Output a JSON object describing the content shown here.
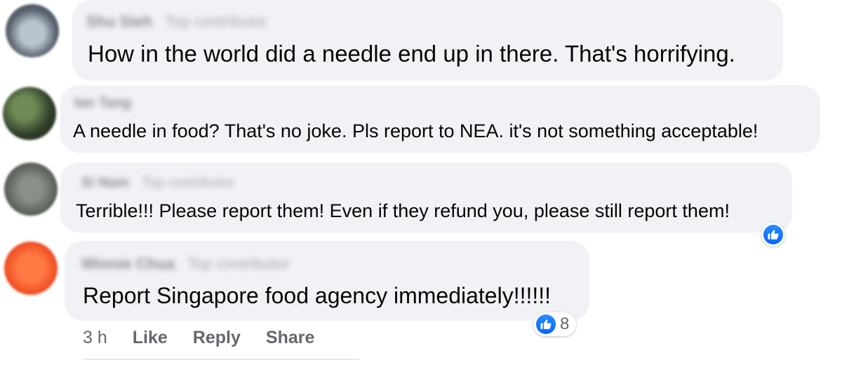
{
  "comments": [
    {
      "author": "Shu Sieh",
      "badge": "Top contributor",
      "text": "How in the world did a needle end up in there. That's horrifying."
    },
    {
      "author": "Ian Tang",
      "badge": "",
      "text": "A needle in food? That's no joke. Pls report to NEA. it's not something acceptable!"
    },
    {
      "author": "Si Nam",
      "badge": "Top contributor",
      "text": "Terrible!!! Please report them! Even if they refund you, please still report them!"
    },
    {
      "author": "Winnie Chua",
      "badge": "Top contributor",
      "text": "Report Singapore food agency immediately!!!!!!",
      "reaction_count": "8"
    }
  ],
  "actions": {
    "time": "3 h",
    "like": "Like",
    "reply": "Reply",
    "share": "Share"
  },
  "colors": {
    "bubble_bg": "#f0f2f5",
    "like_blue": "#0866ff",
    "meta_gray": "#65676b"
  },
  "icons": {
    "reaction": "thumbs-up-icon"
  }
}
